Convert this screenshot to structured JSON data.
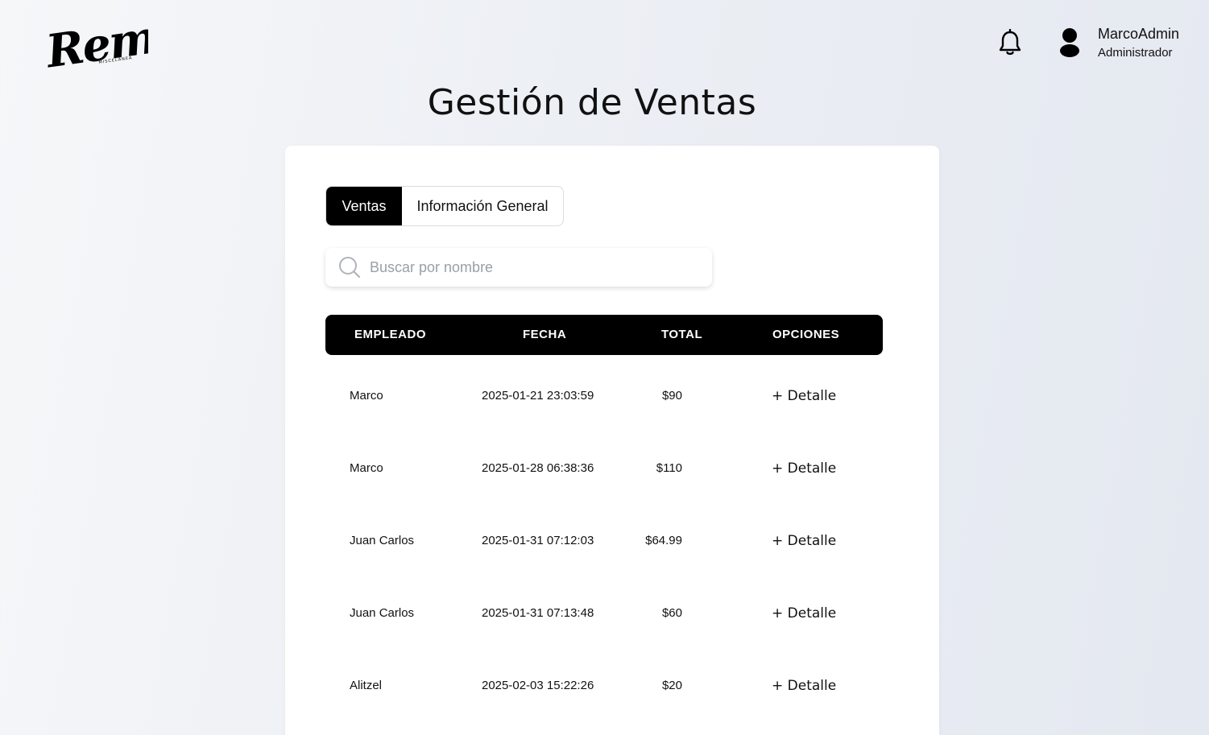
{
  "brand": {
    "logo_text": "Remi",
    "logo_subtext": "MISCELÁNEA"
  },
  "header": {
    "notification_icon": "bell-icon",
    "user_icon": "user-icon",
    "user_name": "MarcoAdmin",
    "user_role": "Administrador"
  },
  "page": {
    "title": "Gestión de Ventas"
  },
  "tabs": [
    {
      "label": "Ventas",
      "active": true
    },
    {
      "label": "Información General",
      "active": false
    }
  ],
  "search": {
    "placeholder": "Buscar por nombre",
    "value": "",
    "icon": "search-icon"
  },
  "table": {
    "headers": [
      "EMPLEADO",
      "FECHA",
      "TOTAL",
      "OPCIONES"
    ],
    "rows": [
      {
        "empleado": "Marco",
        "fecha": "2025-01-21 23:03:59",
        "total": "$90",
        "opcion": "+ Detalle"
      },
      {
        "empleado": "Marco",
        "fecha": "2025-01-28 06:38:36",
        "total": "$110",
        "opcion": "+ Detalle"
      },
      {
        "empleado": "Juan Carlos",
        "fecha": "2025-01-31 07:12:03",
        "total": "$64.99",
        "opcion": "+ Detalle"
      },
      {
        "empleado": "Juan Carlos",
        "fecha": "2025-01-31 07:13:48",
        "total": "$60",
        "opcion": "+ Detalle"
      },
      {
        "empleado": "Alitzel",
        "fecha": "2025-02-03 15:22:26",
        "total": "$20",
        "opcion": "+ Detalle"
      }
    ]
  },
  "colors": {
    "accent": "#000000",
    "card": "#ffffff",
    "background": "#eceff4"
  }
}
